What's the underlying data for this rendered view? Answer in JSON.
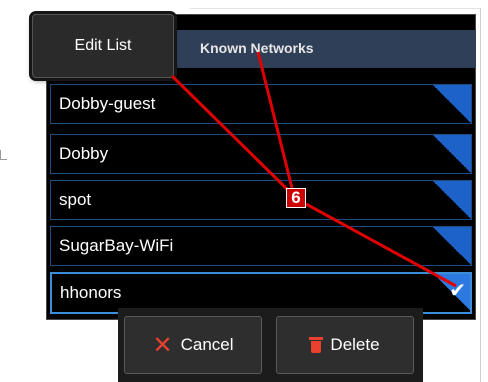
{
  "header": {
    "title": "Known Networks"
  },
  "toolbar": {
    "edit_label": "Edit List"
  },
  "networks": [
    {
      "name": "Dobby-guest",
      "selected": false
    },
    {
      "name": "Dobby",
      "selected": false
    },
    {
      "name": "spot",
      "selected": false
    },
    {
      "name": "SugarBay-WiFi",
      "selected": false
    },
    {
      "name": "hhonors",
      "selected": true
    }
  ],
  "actions": {
    "cancel_label": "Cancel",
    "delete_label": "Delete"
  },
  "callout": {
    "number": "6"
  },
  "icons": {
    "cancel": "x-icon",
    "delete": "trash-icon",
    "selected": "checkmark-icon"
  },
  "colors": {
    "accent": "#1d62c9",
    "selection_border": "#3a8fd8",
    "callout": "#cc0000",
    "danger_icon": "#e8422e",
    "header_band": "#2f3f57"
  }
}
